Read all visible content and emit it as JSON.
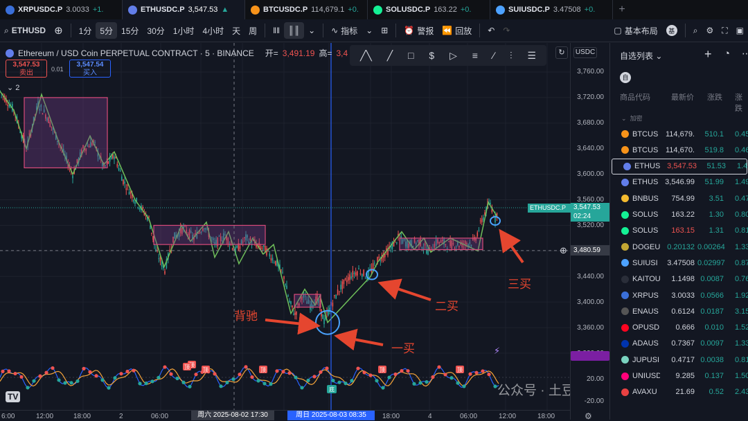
{
  "tabs": [
    {
      "symbol": "XRPUSDC.P",
      "price": "3.0033",
      "change": "+1.",
      "dir": "up",
      "color": "#3a6fd8"
    },
    {
      "symbol": "ETHUSDC.P",
      "price": "3,547.53",
      "change": "▲",
      "dir": "up",
      "color": "#627eea",
      "active": true
    },
    {
      "symbol": "BTCUSDC.P",
      "price": "114,679.1",
      "change": "+0.",
      "dir": "up",
      "color": "#f7931a"
    },
    {
      "symbol": "SOLUSDC.P",
      "price": "163.22",
      "change": "+0.",
      "dir": "up",
      "color": "#14f195"
    },
    {
      "symbol": "SUIUSDC.P",
      "price": "3.47508",
      "change": "+0.",
      "dir": "up",
      "color": "#4da2ff"
    }
  ],
  "toolbar": {
    "symbol": "ETHUSD",
    "intervals": [
      "1分",
      "5分",
      "15分",
      "30分",
      "1小时",
      "4小时",
      "天",
      "周"
    ],
    "selected_interval": "5分",
    "indicators": "指标",
    "alert": "警报",
    "replay": "回放",
    "layout": "基本布局",
    "avatar": "基"
  },
  "legend": {
    "title": "Ethereum / USD Coin PERPETUAL CONTRACT · 5 · BINANCE",
    "open_label": "开=",
    "open": "3,491.19",
    "high_label": "高=",
    "high": "3,4"
  },
  "sell": {
    "price": "3,547.53",
    "label": "卖出"
  },
  "buy": {
    "price": "3,547.54",
    "label": "买入"
  },
  "spread": "0.01",
  "collapse_count": "2",
  "currency": "USDC",
  "price_axis": [
    "3,760.00",
    "3,720.00",
    "3,680.00",
    "3,640.00",
    "3,600.00",
    "3,560.00",
    "3,520.00",
    "3,480.59",
    "3,440.00",
    "3,400.00",
    "3,360.00",
    "3,320.00"
  ],
  "osc_axis": [
    "20.00",
    "-20.00"
  ],
  "last_price_tag": {
    "symbol": "ETHUSDC.P",
    "price": "3,547.53",
    "countdown": "02:24"
  },
  "crosshair_price": "3,480.59",
  "time_axis": [
    "6:00",
    "12:00",
    "18:00",
    "2",
    "06:00",
    "12:00",
    "18:00",
    "4",
    "06:00",
    "12:00",
    "18:00"
  ],
  "crosshair_time_1": "周六 2025-08-02  17:30",
  "crosshair_time_2": "周日 2025-08-03  08:35",
  "annotations": {
    "divergence": "背驰",
    "buy1": "一买",
    "buy2": "二买",
    "buy3": "三买"
  },
  "osc_labels": {
    "top": "顶",
    "bottom": "底"
  },
  "watchlist": {
    "title": "自选列表",
    "tag": "自",
    "headers": [
      "商品代码",
      "最新价",
      "涨跌",
      "涨跌"
    ],
    "group": "加密",
    "rows": [
      {
        "s": "BTCUS",
        "l": "114,679.",
        "c": "510.1",
        "p": "0.45",
        "lc": "#d1d4dc",
        "ico": "#f7931a"
      },
      {
        "s": "BTCUS",
        "l": "114,670.",
        "c": "519.8",
        "p": "0.46",
        "lc": "#d1d4dc",
        "ico": "#f7931a"
      },
      {
        "s": "ETHUS",
        "l": "3,547.53",
        "c": "51.53",
        "p": "1.47",
        "lc": "#ef5350",
        "ico": "#627eea"
      },
      {
        "s": "ETHUS",
        "l": "3,546.99",
        "c": "51.99",
        "p": "1.49",
        "lc": "#d1d4dc",
        "ico": "#627eea"
      },
      {
        "s": "BNBUS",
        "l": "754.99",
        "c": "3.51",
        "p": "0.47",
        "lc": "#d1d4dc",
        "ico": "#f3ba2f"
      },
      {
        "s": "SOLUS",
        "l": "163.22",
        "c": "1.30",
        "p": "0.80",
        "lc": "#d1d4dc",
        "ico": "#14f195"
      },
      {
        "s": "SOLUS",
        "l": "163.15",
        "c": "1.31",
        "p": "0.81",
        "lc": "#ef5350",
        "ico": "#14f195"
      },
      {
        "s": "DOGEU",
        "l": "0.20132",
        "c": "0.00264",
        "p": "1.33",
        "lc": "#26a69a",
        "ico": "#c2a633"
      },
      {
        "s": "SUIUSI",
        "l": "3.47508",
        "c": "0.02997",
        "p": "0.87",
        "lc": "#d1d4dc",
        "ico": "#4da2ff"
      },
      {
        "s": "KAITOU",
        "l": "1.1498",
        "c": "0.0087",
        "p": "0.76",
        "lc": "#d1d4dc",
        "ico": "#2a2e39"
      },
      {
        "s": "XRPUS",
        "l": "3.0033",
        "c": "0.0566",
        "p": "1.92",
        "lc": "#d1d4dc",
        "ico": "#3a6fd8"
      },
      {
        "s": "ENAUS",
        "l": "0.6124",
        "c": "0.0187",
        "p": "3.15",
        "lc": "#d1d4dc",
        "ico": "#555"
      },
      {
        "s": "OPUSD",
        "l": "0.666",
        "c": "0.010",
        "p": "1.52",
        "lc": "#d1d4dc",
        "ico": "#ff0420"
      },
      {
        "s": "ADAUS",
        "l": "0.7367",
        "c": "0.0097",
        "p": "1.33",
        "lc": "#d1d4dc",
        "ico": "#0033ad"
      },
      {
        "s": "JUPUSI",
        "l": "0.4717",
        "c": "0.0038",
        "p": "0.81",
        "lc": "#d1d4dc",
        "ico": "#7ad3c0"
      },
      {
        "s": "UNIUSD",
        "l": "9.285",
        "c": "0.137",
        "p": "1.50",
        "lc": "#d1d4dc",
        "ico": "#ff007a"
      },
      {
        "s": "AVAXU",
        "l": "21.69",
        "c": "0.52",
        "p": "2.43",
        "lc": "#d1d4dc",
        "ico": "#e84142"
      }
    ]
  },
  "watermark": "公众号 · 土豆币市叨"
}
